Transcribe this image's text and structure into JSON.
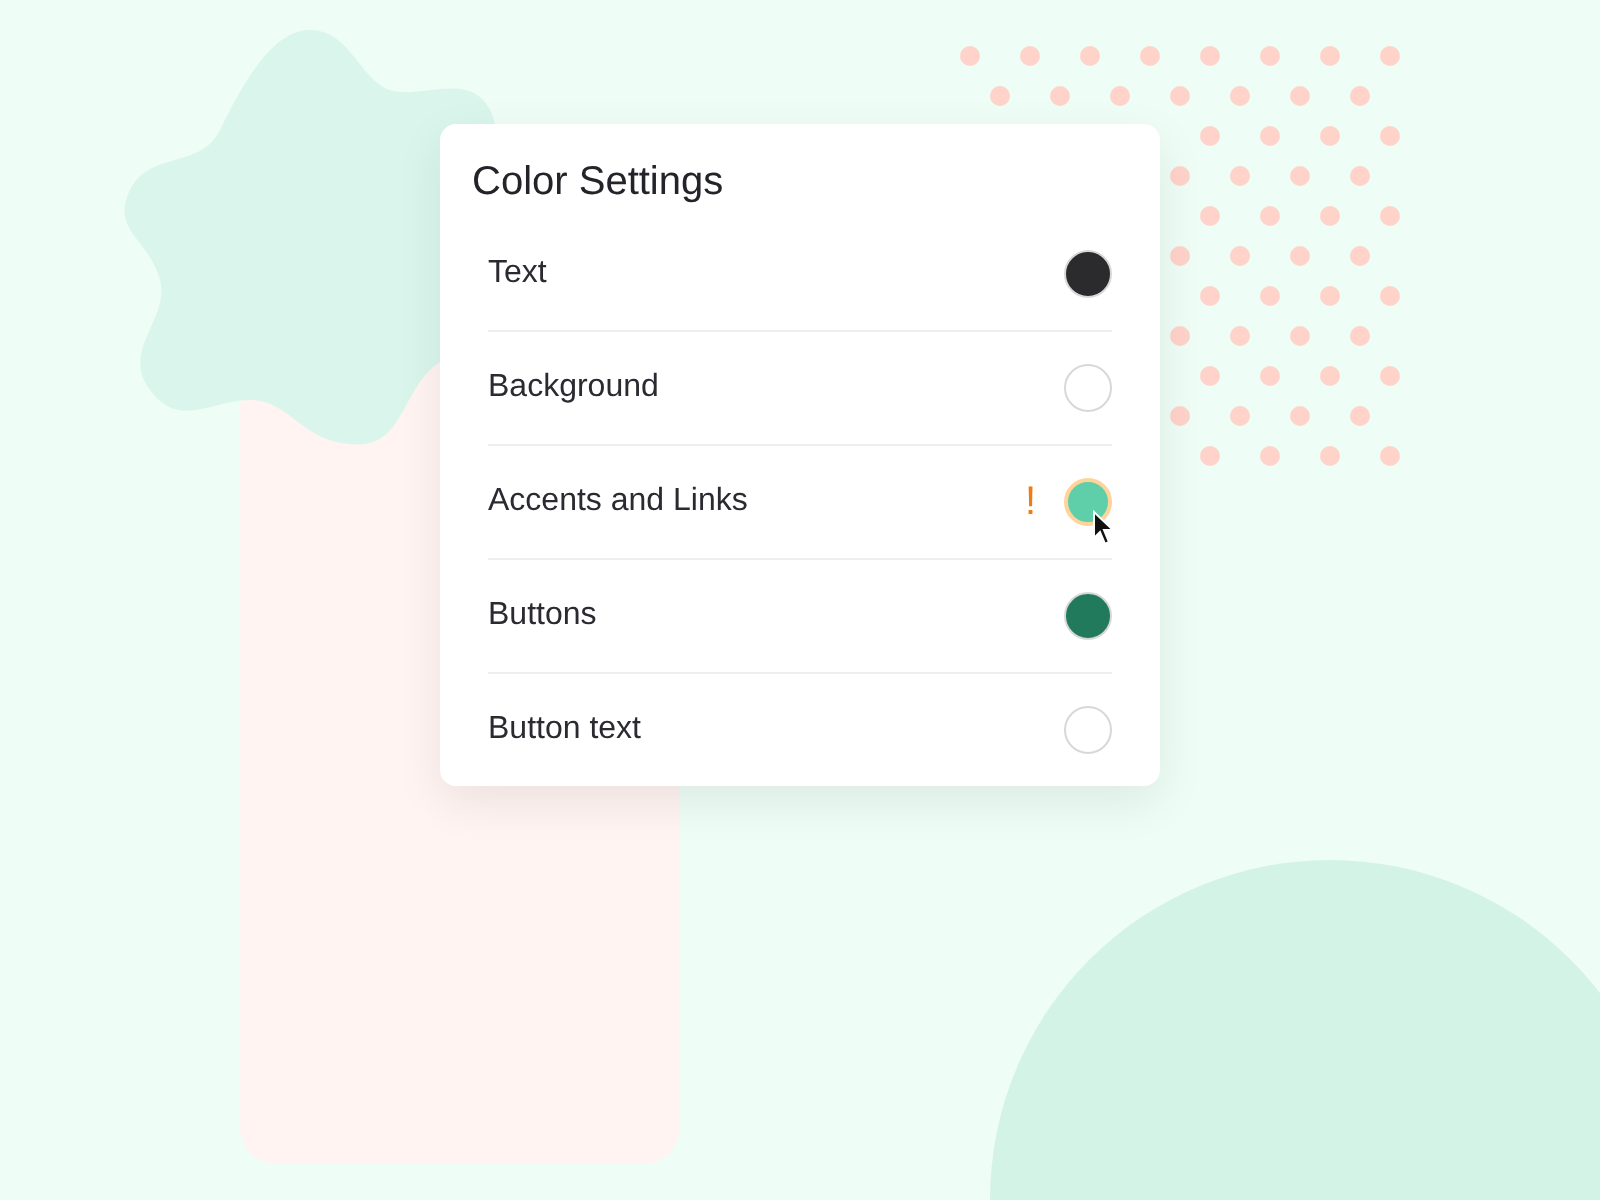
{
  "panel": {
    "title": "Color Settings",
    "items": [
      {
        "label": "Text",
        "color": "#2b2b2e",
        "selected": false
      },
      {
        "label": "Background",
        "color": "#ffffff",
        "selected": false
      },
      {
        "label": "Accents and Links",
        "color": "#5ecfa8",
        "selected": true,
        "warning": "!"
      },
      {
        "label": "Buttons",
        "color": "#227a5c",
        "selected": false
      },
      {
        "label": "Button text",
        "color": "#ffffff",
        "selected": false
      }
    ]
  }
}
